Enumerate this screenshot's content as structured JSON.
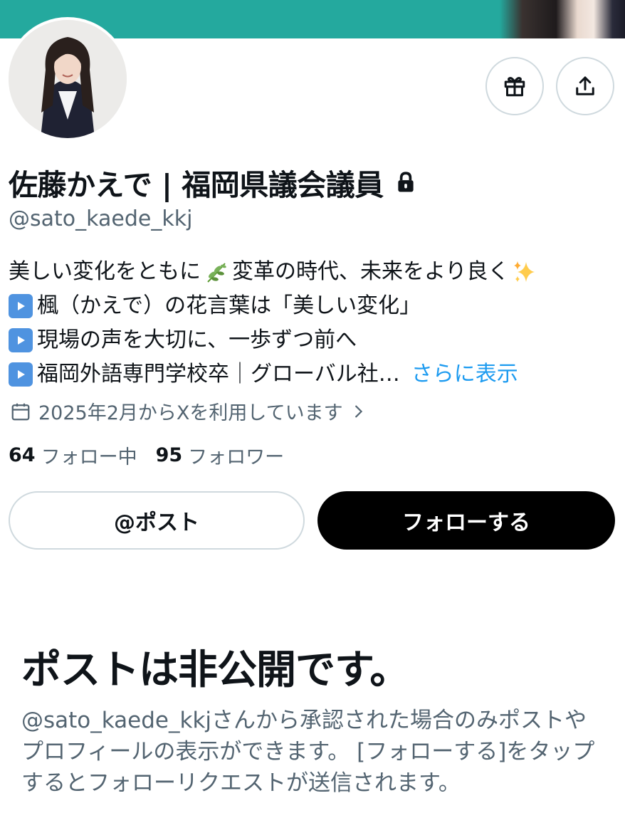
{
  "profile": {
    "name": "佐藤かえで | 福岡県議会議員",
    "handle": "@sato_kaede_kkj",
    "bio": {
      "line1_a": "美しい変化をともに",
      "line1_b": "変革の時代、未来をより良く",
      "line2": "楓（かえで）の花言葉は「美しい変化」",
      "line3": "現場の声を大切に、一歩ずつ前へ",
      "line4": "福岡外語専門学校卒｜グローバル社…",
      "more": "さらに表示"
    },
    "joined": "2025年2月からXを利用しています",
    "following_count": "64",
    "following_label": "フォロー中",
    "followers_count": "95",
    "followers_label": "フォロワー"
  },
  "actions": {
    "post_label": "@ポスト",
    "follow_label": "フォローする"
  },
  "private_notice": {
    "title": "ポストは非公開です。",
    "description": "@sato_kaede_kkjさんから承認された場合のみポストやプロフィールの表示ができます。 [フォローする]をタップするとフォローリクエストが送信されます。"
  },
  "icons": {
    "gift": "gift-icon",
    "share": "share-icon",
    "lock": "lock-icon",
    "calendar": "calendar-icon",
    "chevron": "chevron-right-icon",
    "play": "play-button-emoji",
    "herb": "herb-emoji",
    "sparkles": "sparkles-emoji"
  },
  "colors": {
    "banner": "#24a99e",
    "link": "#1d9bf0",
    "secondary_text": "#536471",
    "follow_button": "#000000"
  }
}
